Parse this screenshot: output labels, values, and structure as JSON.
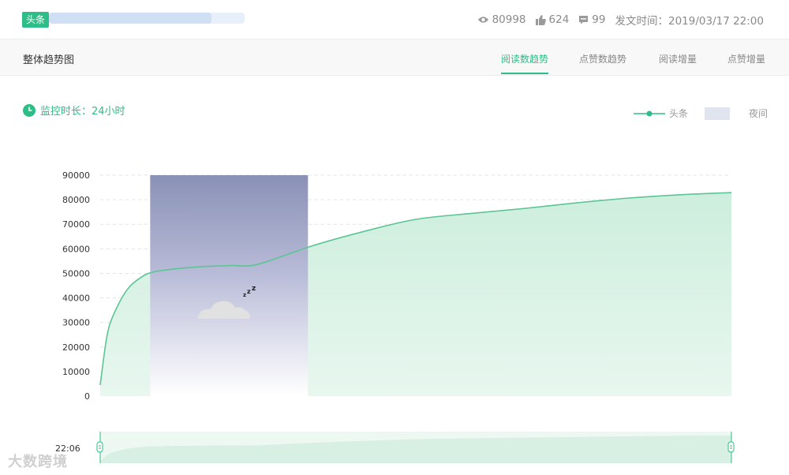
{
  "header": {
    "tag": "头条",
    "views": "80998",
    "likes": "624",
    "comments": "99",
    "publish_time": "发文时间：2019/03/17 22:00"
  },
  "tabs": {
    "section_title": "整体趋势图",
    "items": [
      "阅读数趋势",
      "点赞数趋势",
      "阅读增量",
      "点赞增量"
    ],
    "active": 0
  },
  "monitor": {
    "label": "监控时长：24小时"
  },
  "legend": {
    "series": "头条",
    "night": "夜间"
  },
  "slider": {
    "start_label": "22:06"
  },
  "watermark": "大数跨境",
  "colors": {
    "accent": "#2dbd86",
    "night_top": "#8a91b6",
    "area": "#dff3e8"
  },
  "chart_data": {
    "type": "area",
    "ylim": [
      0,
      90000
    ],
    "yticks": [
      0,
      10000,
      20000,
      30000,
      40000,
      50000,
      60000,
      70000,
      80000,
      90000
    ],
    "series": [
      {
        "name": "头条",
        "x_hours": [
          0,
          0.25,
          0.5,
          1,
          1.5,
          2,
          3,
          4,
          5,
          6,
          8,
          10,
          12,
          14,
          16,
          18,
          20,
          22,
          24
        ],
        "values": [
          4500,
          24000,
          33000,
          43000,
          48000,
          50500,
          52000,
          52800,
          53200,
          53700,
          61000,
          67000,
          72000,
          74300,
          76300,
          78600,
          80600,
          82000,
          82900
        ]
      }
    ],
    "night_band_hours": [
      1.9,
      7.9
    ],
    "grid": true
  }
}
